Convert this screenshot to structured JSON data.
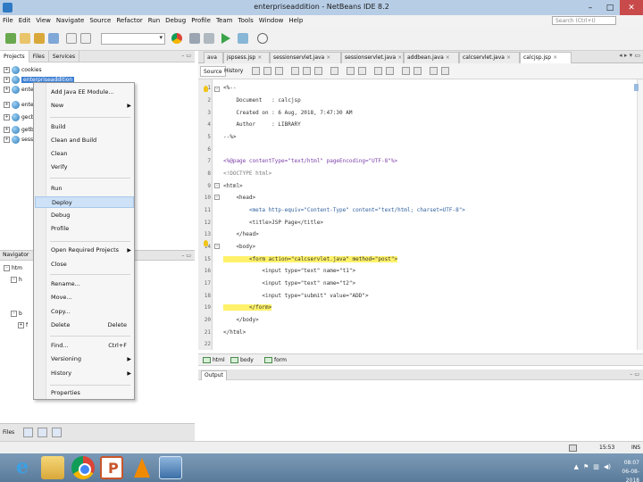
{
  "window": {
    "title": "enterpriseaddition - NetBeans IDE 8.2"
  },
  "menu": [
    "File",
    "Edit",
    "View",
    "Navigate",
    "Source",
    "Refactor",
    "Run",
    "Debug",
    "Profile",
    "Team",
    "Tools",
    "Window",
    "Help"
  ],
  "search": {
    "placeholder": "Search (Ctrl+I)"
  },
  "left_panel": {
    "tabs": [
      "Projects",
      "Files",
      "Services"
    ],
    "tree": [
      {
        "label": "cookies",
        "selected": false
      },
      {
        "label": "enterpriseaddition",
        "selected": true
      },
      {
        "label": "ente",
        "selected": false
      },
      {
        "label": "ente",
        "selected": false
      },
      {
        "label": "gecb",
        "selected": false
      },
      {
        "label": "getb",
        "selected": false
      },
      {
        "label": "sessi",
        "selected": false
      }
    ],
    "navigator_label": "Navigator",
    "navigator_items": [
      "htm",
      "h",
      "b",
      "f"
    ],
    "bottom_label": "Files"
  },
  "context_menu": {
    "items": [
      {
        "label": "Add Java EE Module...",
        "shortcut": "",
        "submenu": false
      },
      {
        "label": "New",
        "shortcut": "",
        "submenu": true
      },
      {
        "label": "Build",
        "shortcut": "",
        "submenu": false
      },
      {
        "label": "Clean and Build",
        "shortcut": "",
        "submenu": false
      },
      {
        "label": "Clean",
        "shortcut": "",
        "submenu": false
      },
      {
        "label": "Verify",
        "shortcut": "",
        "submenu": false
      },
      {
        "label": "Run",
        "shortcut": "",
        "submenu": false
      },
      {
        "label": "Deploy",
        "shortcut": "",
        "submenu": false
      },
      {
        "label": "Debug",
        "shortcut": "",
        "submenu": false
      },
      {
        "label": "Profile",
        "shortcut": "",
        "submenu": false
      },
      {
        "label": "Open Required Projects",
        "shortcut": "",
        "submenu": true
      },
      {
        "label": "Close",
        "shortcut": "",
        "submenu": false
      },
      {
        "label": "Rename...",
        "shortcut": "",
        "submenu": false
      },
      {
        "label": "Move...",
        "shortcut": "",
        "submenu": false
      },
      {
        "label": "Copy...",
        "shortcut": "",
        "submenu": false
      },
      {
        "label": "Delete",
        "shortcut": "Delete",
        "submenu": false
      },
      {
        "label": "Find...",
        "shortcut": "Ctrl+F",
        "submenu": false
      },
      {
        "label": "Versioning",
        "shortcut": "",
        "submenu": true
      },
      {
        "label": "History",
        "shortcut": "",
        "submenu": true
      },
      {
        "label": "Properties",
        "shortcut": "",
        "submenu": false
      }
    ],
    "highlighted": "Deploy"
  },
  "editor": {
    "tabs": [
      {
        "label": "ava",
        "active": false
      },
      {
        "label": "jspsess.jsp",
        "active": false
      },
      {
        "label": "sessionservlet.java",
        "active": false
      },
      {
        "label": "sessionservlet.java",
        "active": false
      },
      {
        "label": "addbean.java",
        "active": false
      },
      {
        "label": "calcservlet.java",
        "active": false
      },
      {
        "label": "calcjsp.jsp",
        "active": true
      }
    ],
    "view_tabs": [
      "Source",
      "History"
    ],
    "lines": [
      {
        "n": "1",
        "text": "<%--"
      },
      {
        "n": "2",
        "text": "    Document   : calcjsp"
      },
      {
        "n": "3",
        "text": "    Created on : 6 Aug, 2018, 7:47:30 AM"
      },
      {
        "n": "4",
        "text": "    Author     : LIBRARY"
      },
      {
        "n": "5",
        "text": "--%>"
      },
      {
        "n": "6",
        "text": ""
      },
      {
        "n": "7",
        "text": "<%@page contentType=\"text/html\" pageEncoding=\"UTF-8\"%>"
      },
      {
        "n": "8",
        "text": "<!DOCTYPE html>"
      },
      {
        "n": "9",
        "text": "<html>"
      },
      {
        "n": "10",
        "text": "    <head>"
      },
      {
        "n": "11",
        "text": "        <meta http-equiv=\"Content-Type\" content=\"text/html; charset=UTF-8\">"
      },
      {
        "n": "12",
        "text": "        <title>JSP Page</title>"
      },
      {
        "n": "13",
        "text": "    </head>"
      },
      {
        "n": "14",
        "text": "    <body>"
      },
      {
        "n": "15",
        "text": "        <form action=\"calcservlet.java\" method=\"post\">"
      },
      {
        "n": "16",
        "text": "            <input type=\"text\" name=\"t1\">"
      },
      {
        "n": "17",
        "text": "            <input type=\"text\" name=\"t2\">"
      },
      {
        "n": "18",
        "text": "            <input type=\"submit\" value=\"ADD\">"
      },
      {
        "n": "19",
        "text": "        </form>"
      },
      {
        "n": "20",
        "text": "    </body>"
      },
      {
        "n": "21",
        "text": "</html>"
      },
      {
        "n": "22",
        "text": ""
      }
    ],
    "breadcrumb": [
      "html",
      "body",
      "form"
    ]
  },
  "output": {
    "label": "Output"
  },
  "status": {
    "position": "15:53",
    "mode": "INS"
  },
  "taskbar": {
    "apps": [
      "internet-explorer",
      "file-explorer",
      "chrome",
      "powerpoint",
      "vlc",
      "netbeans"
    ],
    "time": "08:07",
    "date": "06-08-2018"
  }
}
